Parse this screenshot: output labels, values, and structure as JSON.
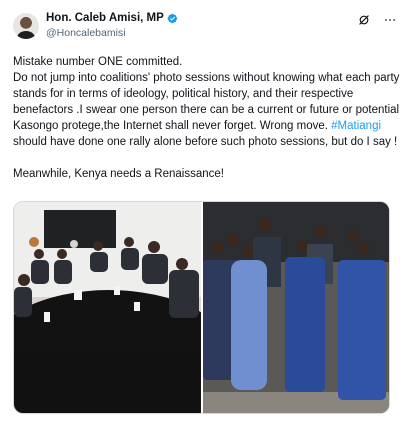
{
  "author": {
    "display_name": "Hon. Caleb Amisi, MP",
    "handle": "@Honcalebamisi",
    "verified": true,
    "avatar_icon": "profile-photo"
  },
  "actions": {
    "grok_icon": "grok-icon",
    "more_icon": "more-icon"
  },
  "tweet": {
    "line1": "Mistake number ONE committed.",
    "para_before_hashtag": "Do not jump into coalitions' photo sessions without knowing what each party stands for in terms of ideology, political history, and their respective benefactors .I swear one person there can be a current or future or potential Kasongo protege,the Internet shall never forget. Wrong move.  ",
    "hashtag": "#Matiangi",
    "para_after_hashtag": " should have done one rally alone before such photo sessions, but do I say !",
    "closing": "Meanwhile, Kenya needs a Renaissance!"
  },
  "media": {
    "photo_count": 2
  },
  "colors": {
    "link": "#1d9bf0",
    "verified": "#1d9bf0",
    "text": "#0f1419",
    "secondary": "#536471"
  }
}
